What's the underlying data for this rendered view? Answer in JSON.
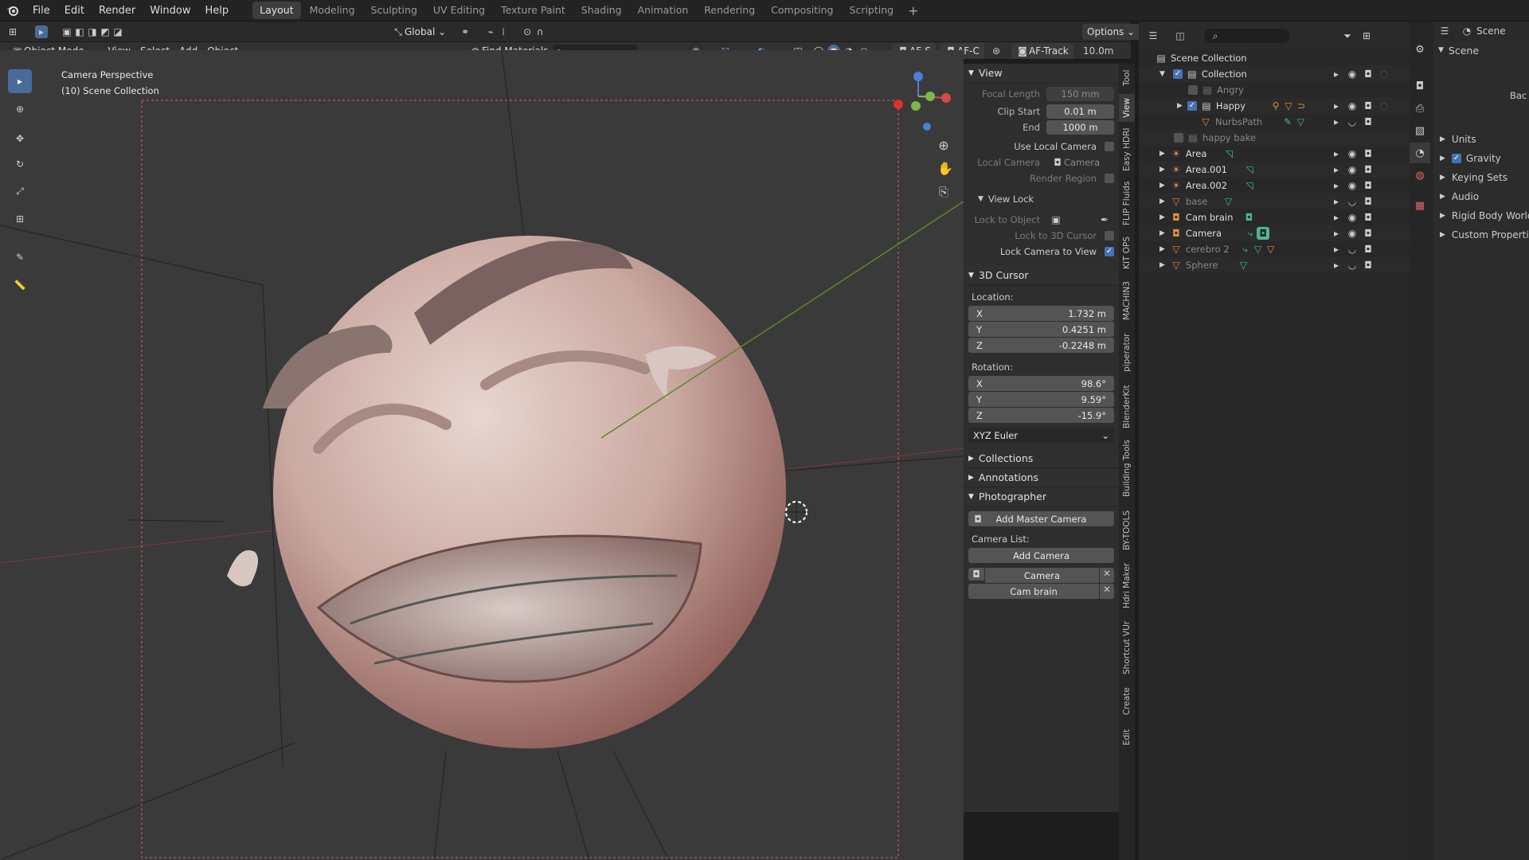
{
  "menu": {
    "file": "File",
    "edit": "Edit",
    "render": "Render",
    "window": "Window",
    "help": "Help"
  },
  "workspaces": [
    "Layout",
    "Modeling",
    "Sculpting",
    "UV Editing",
    "Texture Paint",
    "Shading",
    "Animation",
    "Rendering",
    "Compositing",
    "Scripting"
  ],
  "header": {
    "transform_orientation": "Global",
    "options": "Options",
    "mode": "Object Mode",
    "view": "View",
    "select": "Select",
    "add": "Add",
    "object": "Object",
    "find_materials": "Find Materials",
    "af_s": "AF-S",
    "af_c": "AF-C",
    "af_track": "AF-Track",
    "focus_dist": "10.0m"
  },
  "viewport": {
    "camera_label": "Camera Perspective",
    "collection_label": "(10) Scene Collection"
  },
  "npanel": {
    "view_header": "View",
    "focal_length_label": "Focal Length",
    "focal_length": "150 mm",
    "clip_start_label": "Clip Start",
    "clip_start": "0.01 m",
    "clip_end_label": "End",
    "clip_end": "1000 m",
    "use_local_camera": "Use Local Camera",
    "local_camera_label": "Local Camera",
    "local_camera": "Camera",
    "render_region": "Render Region",
    "view_lock_header": "View Lock",
    "lock_to_object": "Lock to Object",
    "lock_to_cursor": "Lock to 3D Cursor",
    "lock_camera_to_view": "Lock Camera to View",
    "cursor_header": "3D Cursor",
    "location_label": "Location:",
    "loc_x": "1.732 m",
    "loc_y": "0.4251 m",
    "loc_z": "-0.2248 m",
    "rotation_label": "Rotation:",
    "rot_x": "98.6°",
    "rot_y": "9.59°",
    "rot_z": "-15.9°",
    "rotation_mode": "XYZ Euler",
    "collections": "Collections",
    "annotations": "Annotations",
    "photographer": "Photographer",
    "add_master_camera": "Add Master Camera",
    "camera_list": "Camera List:",
    "add_camera": "Add Camera",
    "cam1": "Camera",
    "cam2": "Cam brain",
    "x": "X",
    "y": "Y",
    "z": "Z"
  },
  "vtabs": [
    "Tool",
    "View",
    "Easy HDRI",
    "FLIP Fluids",
    "KIT OPS",
    "MACHIN3",
    "piperator",
    "BlenderKit",
    "Building Tools",
    "BY-TOOLS",
    "Hdri Maker",
    "Shortcut VUr",
    "Create",
    "Edit"
  ],
  "outliner": {
    "scene_collection": "Scene Collection",
    "items": [
      "Collection",
      "Angry",
      "Happy",
      "NurbsPath",
      "happy bake",
      "Area",
      "Area.001",
      "Area.002",
      "base",
      "Cam brain",
      "Camera",
      "cerebro 2",
      "Sphere"
    ]
  },
  "properties": {
    "scene_tab": "Scene",
    "scene_header": "Scene",
    "bac": "Bac",
    "units": "Units",
    "gravity": "Gravity",
    "keying_sets": "Keying Sets",
    "audio": "Audio",
    "rigid_body_world": "Rigid Body World",
    "custom_properties": "Custom Properties"
  },
  "colors": {
    "accent": "#4772b3",
    "header": "#232323",
    "viewport": "#3a3a3a",
    "camera_frame": "#e06060"
  }
}
